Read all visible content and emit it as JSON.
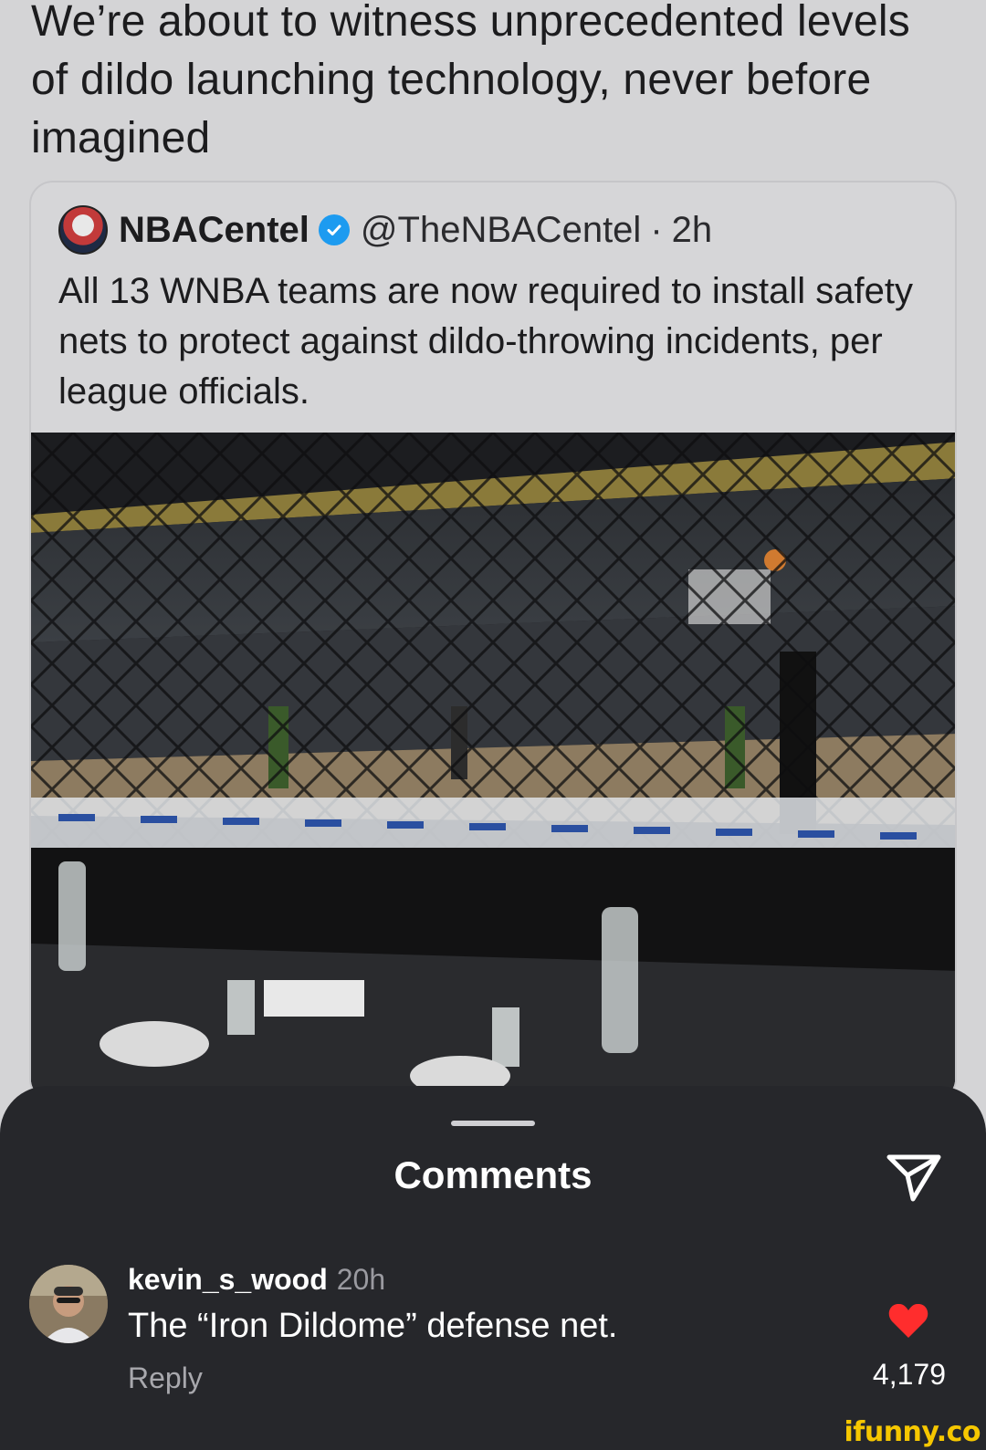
{
  "post": {
    "caption": "We’re about to witness unprecedented levels of dildo launching technology, never before imagined"
  },
  "quoted_tweet": {
    "display_name": "NBACentel",
    "handle": "@TheNBACentel",
    "separator": "·",
    "time": "2h",
    "text": "All 13 WNBA teams are now required to install safety nets to protect against dildo-throwing incidents, per league officials.",
    "icons": {
      "avatar": "nbacentel-logo-icon",
      "verified": "verified-badge-icon"
    },
    "colors": {
      "verified": "#1d9bf0"
    }
  },
  "comments_sheet": {
    "title": "Comments",
    "send_icon": "send-icon",
    "comments": [
      {
        "username": "kevin_s_wood",
        "time": "20h",
        "text": "The “Iron Dildome” defense net.",
        "reply_label": "Reply",
        "likes": "4,179",
        "liked": true,
        "like_color": "#ff2d2d"
      }
    ]
  },
  "watermark": "ifunny.co"
}
